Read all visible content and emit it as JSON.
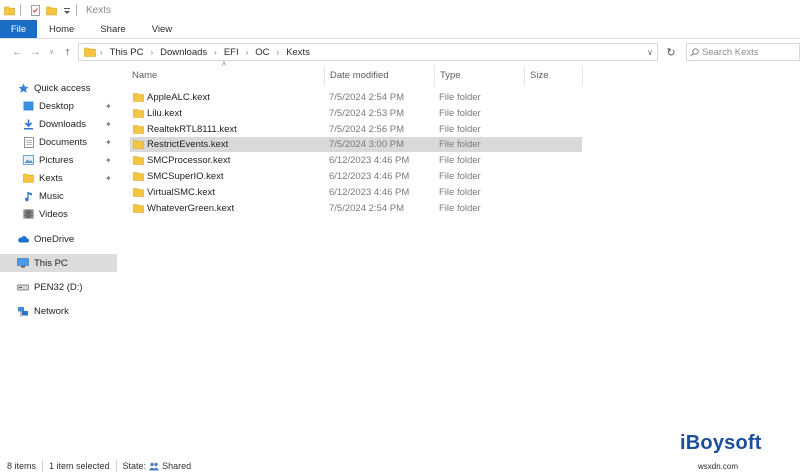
{
  "window": {
    "title": "Kexts"
  },
  "ribbon": {
    "tabs": [
      "File",
      "Home",
      "Share",
      "View"
    ]
  },
  "address": {
    "crumbs": [
      "This PC",
      "Downloads",
      "EFI",
      "OC",
      "Kexts"
    ],
    "search_placeholder": "Search Kexts"
  },
  "nav": {
    "items": [
      {
        "label": "Quick access",
        "icon": "star-icon",
        "pinned": false
      },
      {
        "label": "Desktop",
        "icon": "desktop-icon",
        "pinned": true
      },
      {
        "label": "Downloads",
        "icon": "download-icon",
        "pinned": true
      },
      {
        "label": "Documents",
        "icon": "document-icon",
        "pinned": true
      },
      {
        "label": "Pictures",
        "icon": "pictures-icon",
        "pinned": true
      },
      {
        "label": "Kexts",
        "icon": "folder-icon",
        "pinned": true
      },
      {
        "label": "Music",
        "icon": "music-icon",
        "pinned": false
      },
      {
        "label": "Videos",
        "icon": "videos-icon",
        "pinned": false
      },
      {
        "label": "OneDrive",
        "icon": "cloud-icon",
        "pinned": false
      },
      {
        "label": "This PC",
        "icon": "computer-icon",
        "pinned": false
      },
      {
        "label": "PEN32 (D:)",
        "icon": "drive-icon",
        "pinned": false
      },
      {
        "label": "Network",
        "icon": "network-icon",
        "pinned": false
      }
    ]
  },
  "columns": {
    "name": "Name",
    "date": "Date modified",
    "type": "Type",
    "size": "Size"
  },
  "files": [
    {
      "name": "AppleALC.kext",
      "date": "7/5/2024 2:54 PM",
      "type": "File folder"
    },
    {
      "name": "Lilu.kext",
      "date": "7/5/2024 2:53 PM",
      "type": "File folder"
    },
    {
      "name": "RealtekRTL8111.kext",
      "date": "7/5/2024 2:56 PM",
      "type": "File folder"
    },
    {
      "name": "RestrictEvents.kext",
      "date": "7/5/2024 3:00 PM",
      "type": "File folder"
    },
    {
      "name": "SMCProcessor.kext",
      "date": "6/12/2023 4:46 PM",
      "type": "File folder"
    },
    {
      "name": "SMCSuperIO.kext",
      "date": "6/12/2023 4:46 PM",
      "type": "File folder"
    },
    {
      "name": "VirtualSMC.kext",
      "date": "6/12/2023 4:46 PM",
      "type": "File folder"
    },
    {
      "name": "WhateverGreen.kext",
      "date": "7/5/2024 2:54 PM",
      "type": "File folder"
    }
  ],
  "status": {
    "items": "8 items",
    "selected": "1 item selected",
    "state": "State:",
    "state_value": "Shared"
  },
  "watermark": {
    "text": "iBoysoft",
    "sub": "wsxdn.com"
  },
  "colors": {
    "accent": "#1a6cc4",
    "folder": "#f5c542",
    "selection": "#d9d9d9"
  }
}
